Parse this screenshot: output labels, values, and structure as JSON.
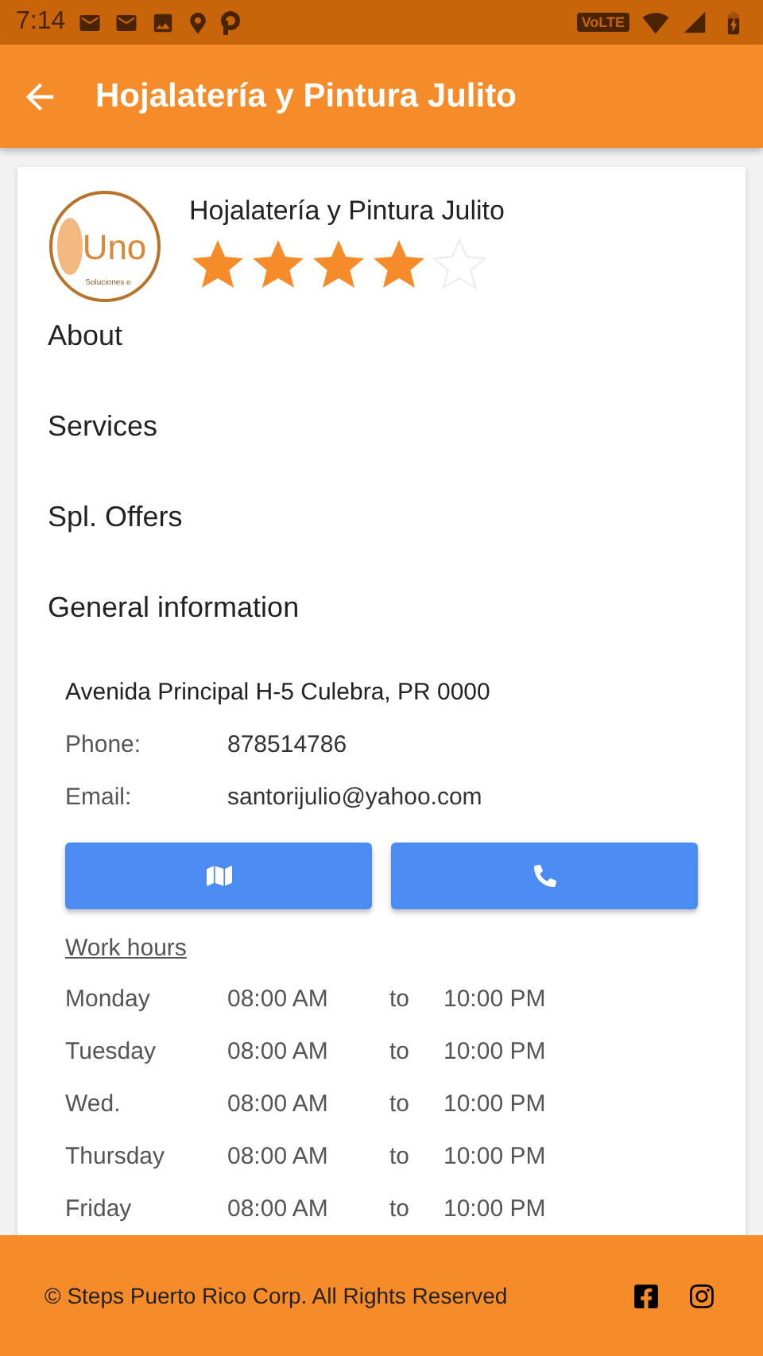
{
  "status_bar": {
    "time": "7:14",
    "network_badge": "VoLTE"
  },
  "app_bar": {
    "title": "Hojalatería y Pintura Julito"
  },
  "business": {
    "logo": {
      "mark": "Uno",
      "tagline": "Soluciones e"
    },
    "name": "Hojalatería y Pintura Julito",
    "stars": 4
  },
  "sections": [
    {
      "label": "About"
    },
    {
      "label": "Services"
    },
    {
      "label": "Spl. Offers"
    }
  ],
  "general_information": {
    "title": "General information",
    "address": "Avenida Principal H-5 Culebra, PR 0000",
    "fields": [
      {
        "label": "Phone:",
        "value": "878514786"
      },
      {
        "label": "Email:",
        "value": "santorijulio@yahoo.com"
      }
    ],
    "actions": [
      {
        "kind": "map"
      },
      {
        "kind": "call"
      }
    ]
  },
  "work_hours": {
    "title": "Work hours",
    "rows": [
      {
        "day": "Monday",
        "open": "08:00 AM",
        "to": "to",
        "close": "10:00 PM"
      },
      {
        "day": "Tuesday",
        "open": "08:00 AM",
        "to": "to",
        "close": "10:00 PM"
      },
      {
        "day": "Wed.",
        "open": "08:00 AM",
        "to": "to",
        "close": "10:00 PM"
      },
      {
        "day": "Thursday",
        "open": "08:00 AM",
        "to": "to",
        "close": "10:00 PM"
      },
      {
        "day": "Friday",
        "open": "08:00 AM",
        "to": "to",
        "close": "10:00 PM"
      }
    ]
  },
  "footer": {
    "copyright": "© Steps Puerto Rico Corp. All Rights Reserved",
    "social": [
      {
        "kind": "facebook"
      },
      {
        "kind": "instagram"
      }
    ]
  }
}
